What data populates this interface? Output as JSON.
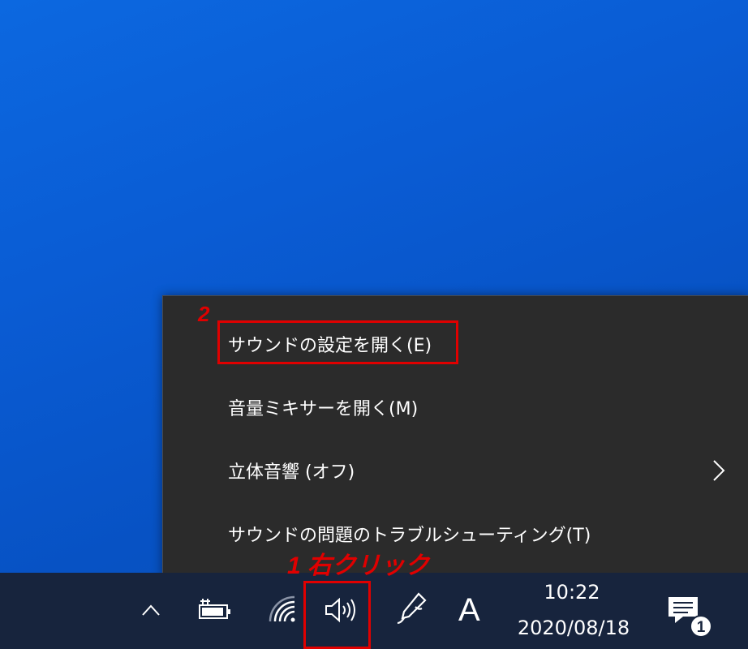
{
  "context_menu": {
    "items": [
      {
        "label": "サウンドの設定を開く(E)"
      },
      {
        "label": "音量ミキサーを開く(M)"
      },
      {
        "label": "立体音響 (オフ)",
        "has_submenu": true
      },
      {
        "label": "サウンドの問題のトラブルシューティング(T)"
      }
    ]
  },
  "annotations": {
    "step1": "1 右クリック",
    "step2": "2",
    "color": "#e00000"
  },
  "taskbar": {
    "icons": [
      "chevron-up-icon",
      "battery-icon",
      "wifi-icon",
      "speaker-icon",
      "pen-icon"
    ],
    "ime_indicator": "A",
    "clock": {
      "time": "10:22",
      "date": "2020/08/18"
    },
    "notification_count": "1"
  },
  "colors": {
    "desktop": "#0a5cd4",
    "menu_bg": "#2b2b2b",
    "taskbar_bg": "#17243d"
  }
}
